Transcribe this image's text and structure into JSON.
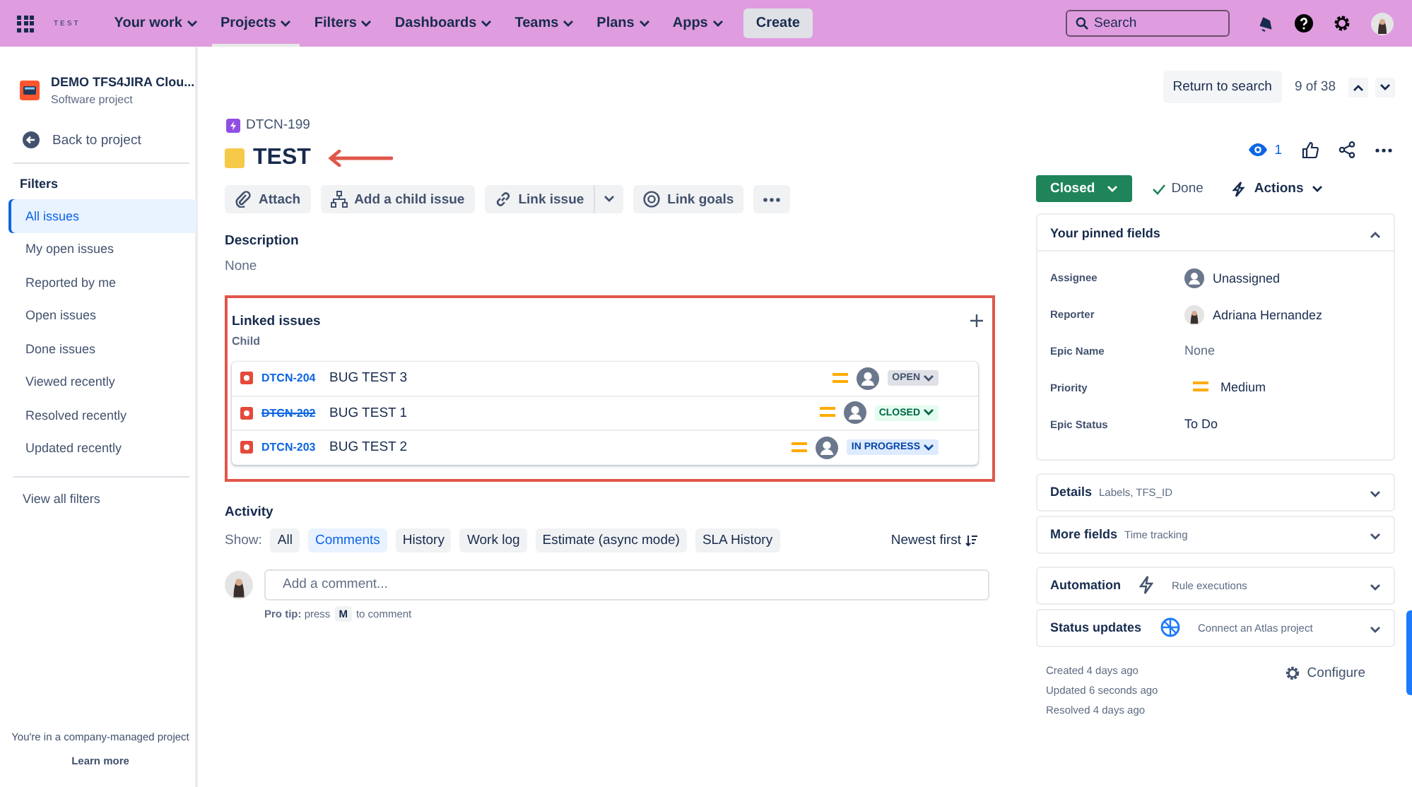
{
  "top_nav": {
    "logo": "TEST",
    "items": [
      {
        "label": "Your work",
        "selected": false
      },
      {
        "label": "Projects",
        "selected": true
      },
      {
        "label": "Filters",
        "selected": false
      },
      {
        "label": "Dashboards",
        "selected": false
      },
      {
        "label": "Teams",
        "selected": false
      },
      {
        "label": "Plans",
        "selected": false
      },
      {
        "label": "Apps",
        "selected": false
      }
    ],
    "create": "Create",
    "search": {
      "placeholder": "Search"
    }
  },
  "sidebar": {
    "project": {
      "name": "DEMO TFS4JIRA Clou...",
      "type": "Software project"
    },
    "back": "Back to project",
    "filters_heading": "Filters",
    "filters": [
      {
        "label": "All issues",
        "selected": true
      },
      {
        "label": "My open issues",
        "selected": false
      },
      {
        "label": "Reported by me",
        "selected": false
      },
      {
        "label": "Open issues",
        "selected": false
      },
      {
        "label": "Done issues",
        "selected": false
      },
      {
        "label": "Viewed recently",
        "selected": false
      },
      {
        "label": "Resolved recently",
        "selected": false
      },
      {
        "label": "Updated recently",
        "selected": false
      }
    ],
    "view_all": "View all filters",
    "footer": {
      "text": "You're in a company-managed project",
      "link": "Learn more"
    }
  },
  "navigation": {
    "return": "Return to search",
    "position": "9 of 38"
  },
  "issue": {
    "key": "DTCN-199",
    "title": "TEST",
    "watchers": "1",
    "toolbar": [
      {
        "kind": "attach",
        "label": "Attach"
      },
      {
        "kind": "child",
        "label": "Add a child issue"
      },
      {
        "kind": "link",
        "label": "Link issue"
      },
      {
        "kind": "goals",
        "label": "Link goals"
      }
    ],
    "description": {
      "heading": "Description",
      "value": "None"
    },
    "linked_issues": {
      "heading": "Linked issues",
      "group": "Child",
      "rows": [
        {
          "key": "DTCN-204",
          "summary": "BUG TEST 3",
          "resolved": false,
          "status": "OPEN",
          "kind": "open"
        },
        {
          "key": "DTCN-202",
          "summary": "BUG TEST 1",
          "resolved": true,
          "status": "CLOSED",
          "kind": "closed"
        },
        {
          "key": "DTCN-203",
          "summary": "BUG TEST 2",
          "resolved": false,
          "status": "IN PROGRESS",
          "kind": "in-progress"
        }
      ]
    },
    "activity": {
      "heading": "Activity",
      "show_label": "Show:",
      "filters": [
        {
          "label": "All",
          "selected": false
        },
        {
          "label": "Comments",
          "selected": true
        },
        {
          "label": "History",
          "selected": false
        },
        {
          "label": "Work log",
          "selected": false
        },
        {
          "label": "Estimate (async mode)",
          "selected": false
        },
        {
          "label": "SLA History",
          "selected": false
        }
      ],
      "sort": "Newest first",
      "comment": {
        "placeholder": "Add a comment..."
      },
      "tip": {
        "text": "**Pro tip:** press",
        "key": "M",
        "after": "to comment"
      }
    }
  },
  "details": {
    "status": {
      "label": "Closed",
      "kind": "done"
    },
    "resolution": "Done",
    "actions": "Actions",
    "pinned": {
      "heading": "Your pinned fields",
      "expanded": true,
      "fields": [
        {
          "label": "Assignee",
          "value": "Unassigned",
          "kind": "avatar-empty"
        },
        {
          "label": "Reporter",
          "value": "Adriana Hernandez",
          "kind": "avatar-person"
        },
        {
          "label": "Epic Name",
          "value": "None",
          "kind": "empty"
        },
        {
          "label": "Priority",
          "value": "Medium",
          "kind": "priority"
        },
        {
          "label": "Epic Status",
          "value": "To Do",
          "kind": "plain"
        }
      ]
    },
    "panels": [
      {
        "title": "Details",
        "hint": "Labels, TFS_ID",
        "kind": "plain",
        "expanded": false
      },
      {
        "title": "More fields",
        "hint": "Time tracking",
        "kind": "plain",
        "expanded": false
      },
      {
        "title": "Automation",
        "hint": "Rule executions",
        "kind": "automation",
        "expanded": false
      },
      {
        "title": "Status updates",
        "hint": "Connect an Atlas project",
        "kind": "atlas",
        "expanded": false
      }
    ],
    "dates": [
      "Created 4 days ago",
      "Updated 6 seconds ago",
      "Resolved 4 days ago"
    ],
    "configure": "Configure"
  }
}
